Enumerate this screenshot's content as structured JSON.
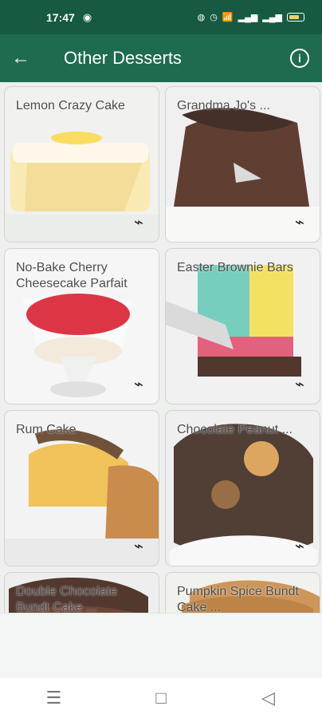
{
  "status": {
    "time": "17:47",
    "sync_icon": "sync-icon",
    "icons": [
      "app-icon",
      "alarm-icon",
      "wifi-icon",
      "signal-icon",
      "signal-icon",
      "battery-icon"
    ]
  },
  "header": {
    "title": "Other Desserts"
  },
  "cards": [
    {
      "title": "Lemon Crazy Cake"
    },
    {
      "title": "Grandma Jo's ..."
    },
    {
      "title": "No-Bake Cherry Cheesecake Parfait"
    },
    {
      "title": "Easter Brownie Bars"
    },
    {
      "title": "Rum Cake"
    },
    {
      "title": "Chocolate Peanut ..."
    },
    {
      "title": "Double Chocolate Bundt Cake ..."
    },
    {
      "title": "Pumpkin Spice Bundt Cake ..."
    }
  ],
  "colors": {
    "status": "#165a41",
    "app_bar": "#1e6b4f",
    "background": "#eef0ee"
  }
}
